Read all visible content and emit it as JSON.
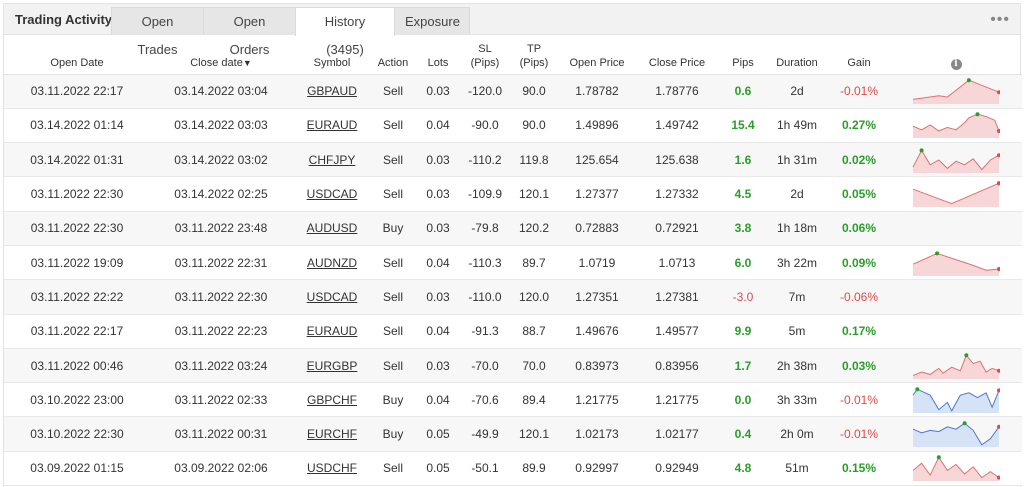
{
  "tabs": {
    "title": "Trading Activity",
    "items": [
      "Open Trades",
      "Open Orders",
      "History (3495)",
      "Exposure"
    ],
    "more": "•••"
  },
  "headers": {
    "open_date": "Open Date",
    "close_date": "Close date",
    "symbol": "Symbol",
    "action": "Action",
    "lots": "Lots",
    "sl_1": "SL",
    "sl_2": "(Pips)",
    "tp_1": "TP",
    "tp_2": "(Pips)",
    "open_price": "Open Price",
    "close_price": "Close Price",
    "pips": "Pips",
    "duration": "Duration",
    "gain": "Gain",
    "info": "i"
  },
  "rows": [
    {
      "open_date": "03.11.2022 22:17",
      "close_date": "03.14.2022 03:04",
      "symbol": "GBPAUD",
      "action": "Sell",
      "lots": "0.03",
      "sl": "-120.0",
      "tp": "90.0",
      "open_price": "1.78782",
      "close_price": "1.78776",
      "pips": "0.6",
      "duration": "2d",
      "gain": "-0.01%",
      "pips_sign": "pos",
      "gain_sign": "neg",
      "spark": {
        "type": "red",
        "points": [
          [
            0,
            0.85
          ],
          [
            0.3,
            0.7
          ],
          [
            0.4,
            0.75
          ],
          [
            0.65,
            0.05
          ],
          [
            1,
            0.55
          ]
        ]
      }
    },
    {
      "open_date": "03.14.2022 01:14",
      "close_date": "03.14.2022 03:03",
      "symbol": "EURAUD",
      "action": "Sell",
      "lots": "0.04",
      "sl": "-90.0",
      "tp": "90.0",
      "open_price": "1.49896",
      "close_price": "1.49742",
      "pips": "15.4",
      "duration": "1h 49m",
      "gain": "0.27%",
      "pips_sign": "pos",
      "gain_sign": "pos",
      "spark": {
        "type": "red",
        "points": [
          [
            0,
            0.55
          ],
          [
            0.1,
            0.7
          ],
          [
            0.2,
            0.5
          ],
          [
            0.3,
            0.75
          ],
          [
            0.4,
            0.6
          ],
          [
            0.5,
            0.7
          ],
          [
            0.6,
            0.4
          ],
          [
            0.65,
            0.2
          ],
          [
            0.75,
            0.05
          ],
          [
            0.85,
            0.15
          ],
          [
            0.95,
            0.3
          ],
          [
            1,
            0.75
          ]
        ]
      }
    },
    {
      "open_date": "03.14.2022 01:31",
      "close_date": "03.14.2022 03:02",
      "symbol": "CHFJPY",
      "action": "Sell",
      "lots": "0.03",
      "sl": "-110.2",
      "tp": "119.8",
      "open_price": "125.654",
      "close_price": "125.638",
      "pips": "1.6",
      "duration": "1h 31m",
      "gain": "0.02%",
      "pips_sign": "pos",
      "gain_sign": "pos",
      "spark": {
        "type": "red",
        "points": [
          [
            0,
            0.8
          ],
          [
            0.1,
            0.1
          ],
          [
            0.2,
            0.7
          ],
          [
            0.3,
            0.5
          ],
          [
            0.4,
            0.85
          ],
          [
            0.5,
            0.55
          ],
          [
            0.6,
            0.7
          ],
          [
            0.7,
            0.45
          ],
          [
            0.8,
            0.9
          ],
          [
            0.9,
            0.5
          ],
          [
            1,
            0.3
          ]
        ]
      }
    },
    {
      "open_date": "03.11.2022 22:30",
      "close_date": "03.14.2022 02:25",
      "symbol": "USDCAD",
      "action": "Sell",
      "lots": "0.03",
      "sl": "-109.9",
      "tp": "120.1",
      "open_price": "1.27377",
      "close_price": "1.27332",
      "pips": "4.5",
      "duration": "2d",
      "gain": "0.05%",
      "pips_sign": "pos",
      "gain_sign": "pos",
      "spark": {
        "type": "red",
        "points": [
          [
            0,
            0.3
          ],
          [
            0.45,
            0.9
          ],
          [
            1,
            0.05
          ]
        ]
      }
    },
    {
      "open_date": "03.11.2022 22:30",
      "close_date": "03.11.2022 23:48",
      "symbol": "AUDUSD",
      "action": "Buy",
      "lots": "0.03",
      "sl": "-79.8",
      "tp": "120.2",
      "open_price": "0.72883",
      "close_price": "0.72921",
      "pips": "3.8",
      "duration": "1h 18m",
      "gain": "0.06%",
      "pips_sign": "pos",
      "gain_sign": "pos",
      "spark": null
    },
    {
      "open_date": "03.11.2022 19:09",
      "close_date": "03.11.2022 22:31",
      "symbol": "AUDNZD",
      "action": "Sell",
      "lots": "0.04",
      "sl": "-110.3",
      "tp": "89.7",
      "open_price": "1.0719",
      "close_price": "1.0713",
      "pips": "6.0",
      "duration": "3h 22m",
      "gain": "0.09%",
      "pips_sign": "pos",
      "gain_sign": "pos",
      "spark": {
        "type": "red",
        "points": [
          [
            0,
            0.55
          ],
          [
            0.28,
            0.1
          ],
          [
            0.7,
            0.6
          ],
          [
            0.85,
            0.8
          ],
          [
            1,
            0.75
          ]
        ]
      }
    },
    {
      "open_date": "03.11.2022 22:22",
      "close_date": "03.11.2022 22:30",
      "symbol": "USDCAD",
      "action": "Sell",
      "lots": "0.03",
      "sl": "-110.0",
      "tp": "120.0",
      "open_price": "1.27351",
      "close_price": "1.27381",
      "pips": "-3.0",
      "duration": "7m",
      "gain": "-0.06%",
      "pips_sign": "neg",
      "gain_sign": "neg",
      "spark": null
    },
    {
      "open_date": "03.11.2022 22:17",
      "close_date": "03.11.2022 22:23",
      "symbol": "EURAUD",
      "action": "Sell",
      "lots": "0.04",
      "sl": "-91.3",
      "tp": "88.7",
      "open_price": "1.49676",
      "close_price": "1.49577",
      "pips": "9.9",
      "duration": "5m",
      "gain": "0.17%",
      "pips_sign": "pos",
      "gain_sign": "pos",
      "spark": null
    },
    {
      "open_date": "03.11.2022 00:46",
      "close_date": "03.11.2022 03:24",
      "symbol": "EURGBP",
      "action": "Sell",
      "lots": "0.03",
      "sl": "-70.0",
      "tp": "70.0",
      "open_price": "0.83973",
      "close_price": "0.83956",
      "pips": "1.7",
      "duration": "2h 38m",
      "gain": "0.03%",
      "pips_sign": "pos",
      "gain_sign": "pos",
      "spark": {
        "type": "red",
        "points": [
          [
            0,
            0.9
          ],
          [
            0.1,
            0.75
          ],
          [
            0.2,
            0.85
          ],
          [
            0.3,
            0.6
          ],
          [
            0.35,
            0.8
          ],
          [
            0.45,
            0.55
          ],
          [
            0.55,
            0.7
          ],
          [
            0.62,
            0.05
          ],
          [
            0.7,
            0.4
          ],
          [
            0.78,
            0.3
          ],
          [
            0.85,
            0.75
          ],
          [
            0.92,
            0.6
          ],
          [
            1,
            0.7
          ]
        ]
      }
    },
    {
      "open_date": "03.10.2022 23:00",
      "close_date": "03.11.2022 02:33",
      "symbol": "GBPCHF",
      "action": "Buy",
      "lots": "0.04",
      "sl": "-70.6",
      "tp": "89.4",
      "open_price": "1.21775",
      "close_price": "1.21775",
      "pips": "0.0",
      "duration": "3h 33m",
      "gain": "-0.01%",
      "pips_sign": "zero",
      "gain_sign": "neg",
      "spark": {
        "type": "blue",
        "points": [
          [
            0,
            0.3
          ],
          [
            0.05,
            0.05
          ],
          [
            0.2,
            0.3
          ],
          [
            0.3,
            0.9
          ],
          [
            0.4,
            0.6
          ],
          [
            0.45,
            0.95
          ],
          [
            0.55,
            0.3
          ],
          [
            0.65,
            0.2
          ],
          [
            0.75,
            0.4
          ],
          [
            0.85,
            0.2
          ],
          [
            0.92,
            0.8
          ],
          [
            1,
            0.1
          ]
        ]
      }
    },
    {
      "open_date": "03.10.2022 22:30",
      "close_date": "03.11.2022 00:31",
      "symbol": "EURCHF",
      "action": "Buy",
      "lots": "0.05",
      "sl": "-49.9",
      "tp": "120.1",
      "open_price": "1.02173",
      "close_price": "1.02177",
      "pips": "0.4",
      "duration": "2h 0m",
      "gain": "-0.01%",
      "pips_sign": "pos",
      "gain_sign": "neg",
      "spark": {
        "type": "blue",
        "points": [
          [
            0,
            0.3
          ],
          [
            0.1,
            0.45
          ],
          [
            0.2,
            0.35
          ],
          [
            0.3,
            0.4
          ],
          [
            0.4,
            0.2
          ],
          [
            0.5,
            0.3
          ],
          [
            0.6,
            0.05
          ],
          [
            0.7,
            0.35
          ],
          [
            0.8,
            0.95
          ],
          [
            0.9,
            0.7
          ],
          [
            1,
            0.2
          ]
        ]
      }
    },
    {
      "open_date": "03.09.2022 01:15",
      "close_date": "03.09.2022 02:06",
      "symbol": "USDCHF",
      "action": "Sell",
      "lots": "0.05",
      "sl": "-50.1",
      "tp": "89.9",
      "open_price": "0.92997",
      "close_price": "0.92949",
      "pips": "4.8",
      "duration": "51m",
      "gain": "0.15%",
      "pips_sign": "pos",
      "gain_sign": "pos",
      "spark": {
        "type": "red",
        "points": [
          [
            0,
            0.6
          ],
          [
            0.1,
            0.3
          ],
          [
            0.2,
            0.8
          ],
          [
            0.3,
            0.05
          ],
          [
            0.4,
            0.6
          ],
          [
            0.5,
            0.35
          ],
          [
            0.6,
            0.75
          ],
          [
            0.7,
            0.45
          ],
          [
            0.8,
            0.9
          ],
          [
            0.9,
            0.65
          ],
          [
            1,
            0.9
          ]
        ]
      }
    }
  ],
  "colors": {
    "pos": "#2a9d2a",
    "neg": "#e04a4a",
    "spark_red_line": "#e07070",
    "spark_red_fill": "#f6d6d6",
    "spark_blue_line": "#4a78d4",
    "spark_blue_fill": "#d6e2f6"
  }
}
